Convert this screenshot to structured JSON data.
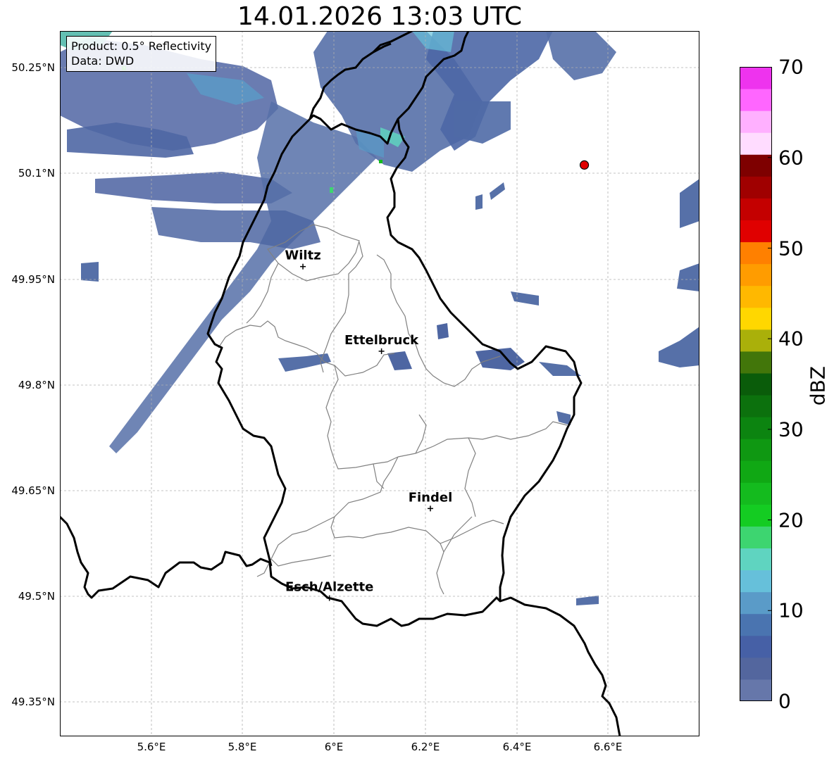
{
  "title": "14.01.2026 13:03 UTC",
  "info_box": {
    "product": "Product: 0.5° Reflectivity",
    "source": "Data: DWD"
  },
  "lat_ticks": [
    "50.25°N",
    "50.1°N",
    "49.95°N",
    "49.8°N",
    "49.65°N",
    "49.5°N",
    "49.35°N"
  ],
  "lon_ticks": [
    "5.6°E",
    "5.8°E",
    "6°E",
    "6.2°E",
    "6.4°E",
    "6.6°E"
  ],
  "places": [
    {
      "name": "Wiltz",
      "lon": 5.932,
      "lat": 49.966
    },
    {
      "name": "Ettelbruck",
      "lon": 6.104,
      "lat": 49.846
    },
    {
      "name": "Findel",
      "lon": 6.211,
      "lat": 49.623
    },
    {
      "name": "Esch/Alzette",
      "lon": 5.99,
      "lat": 49.496
    }
  ],
  "marker": {
    "lon": 6.548,
    "lat": 50.11,
    "color": "#e00000"
  },
  "colorbar": {
    "label": "dBZ",
    "ticks": [
      "0",
      "10",
      "20",
      "30",
      "40",
      "50",
      "60",
      "70"
    ],
    "colors": [
      "#6677aa",
      "#53669e",
      "#4660a6",
      "#4a74b0",
      "#5a9bc8",
      "#66c0da",
      "#5fd4c0",
      "#3dd570",
      "#14cc22",
      "#14bb1e",
      "#10a814",
      "#0f9812",
      "#0c8410",
      "#0c710d",
      "#0a5c0a",
      "#42760a",
      "#aab00a",
      "#ffd700",
      "#ffb800",
      "#ff9c00",
      "#ff8000",
      "#e00000",
      "#c40000",
      "#a00000",
      "#7e0000",
      "#ffdcff",
      "#ffb0ff",
      "#ff66ff",
      "#ee33ee"
    ]
  },
  "map_extent": {
    "lon_min": 5.4,
    "lon_max": 6.8,
    "lat_min": 49.3,
    "lat_max": 50.3
  }
}
